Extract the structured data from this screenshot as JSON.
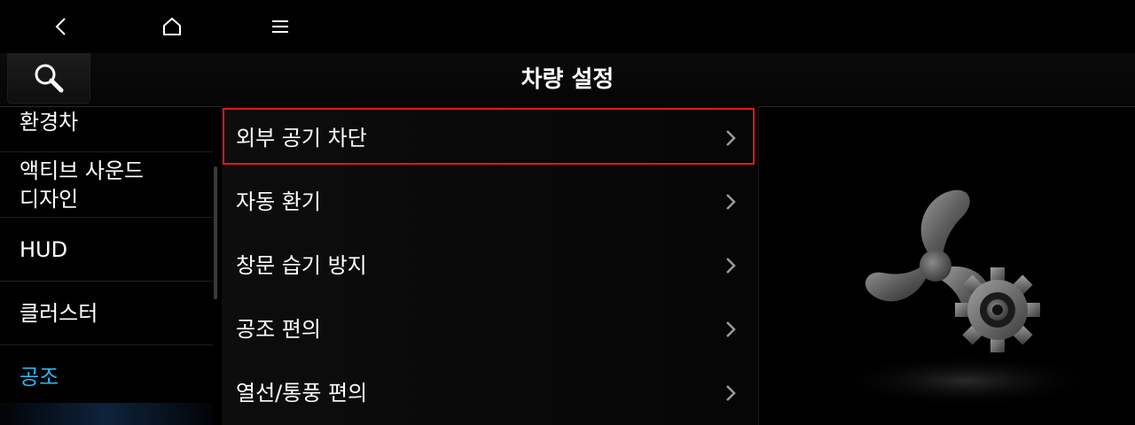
{
  "topnav": {
    "back_icon": "chevron-left-icon",
    "home_icon": "home-icon",
    "menu_icon": "hamburger-menu-icon"
  },
  "header": {
    "search_icon": "search-icon",
    "title": "차량 설정"
  },
  "sidebar": {
    "items": [
      {
        "label": "환경차",
        "active": false
      },
      {
        "label": "액티브 사운드",
        "label2": "디자인",
        "active": false
      },
      {
        "label": "HUD",
        "active": false
      },
      {
        "label": "클러스터",
        "active": false
      },
      {
        "label": "공조",
        "active": true
      }
    ],
    "active_color": "#2db5f0"
  },
  "list": {
    "items": [
      {
        "label": "외부 공기 차단",
        "highlighted": true
      },
      {
        "label": "자동 환기"
      },
      {
        "label": "창문 습기 방지"
      },
      {
        "label": "공조 편의"
      },
      {
        "label": "열선/통풍 편의"
      }
    ],
    "chevron_icon": "chevron-right-icon",
    "highlight_color": "#e8141c"
  },
  "illustration": {
    "icon": "fan-gear-icon"
  }
}
